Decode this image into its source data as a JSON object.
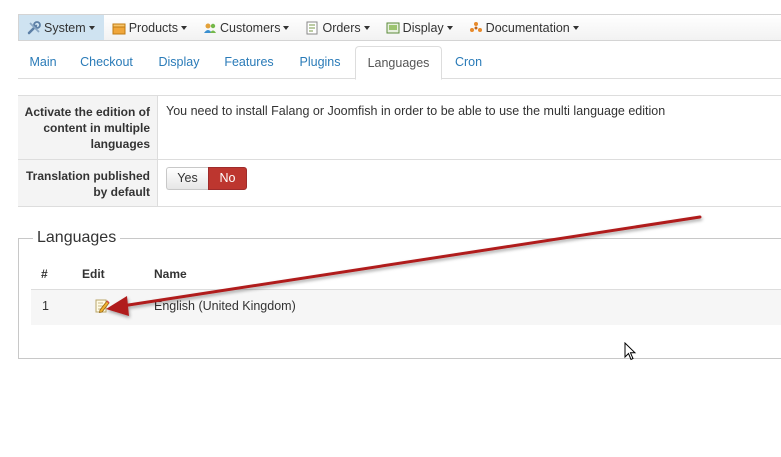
{
  "menu": {
    "items": [
      {
        "label": "System",
        "icon": "tools-icon",
        "active": true
      },
      {
        "label": "Products",
        "icon": "box-icon"
      },
      {
        "label": "Customers",
        "icon": "users-icon"
      },
      {
        "label": "Orders",
        "icon": "orders-icon"
      },
      {
        "label": "Display",
        "icon": "display-icon"
      },
      {
        "label": "Documentation",
        "icon": "documentation-icon"
      }
    ]
  },
  "tabs": {
    "items": [
      "Main",
      "Checkout",
      "Display",
      "Features",
      "Plugins",
      "Languages",
      "Cron"
    ],
    "active": "Languages"
  },
  "settings": {
    "rows": [
      {
        "label": "Activate the edition of content in multiple languages",
        "value": "You need to install Falang or Joomfish in order to be able to use the multi language edition"
      },
      {
        "label": "Translation published by default",
        "yes": "Yes",
        "no": "No",
        "selected": "No"
      }
    ]
  },
  "languages": {
    "legend": "Languages",
    "headers": [
      "#",
      "Edit",
      "Name"
    ],
    "rows": [
      {
        "num": "1",
        "name": "English (United Kingdom)"
      }
    ]
  },
  "colors": {
    "active_menu_bg": "#cfe3f1",
    "tab_link": "#2a7bb8",
    "no_button": "#bd362f",
    "arrow": "#b01c1c"
  }
}
